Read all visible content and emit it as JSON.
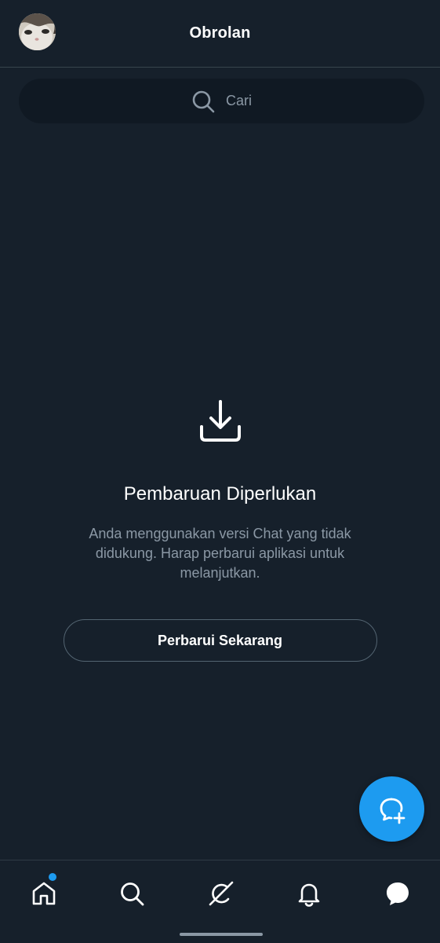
{
  "header": {
    "title": "Obrolan"
  },
  "search": {
    "placeholder": "Cari"
  },
  "empty_state": {
    "icon": "download-icon",
    "title": "Pembaruan Diperlukan",
    "description": "Anda menggunakan versi Chat yang tidak didukung. Harap perbarui aplikasi untuk melanjutkan.",
    "button_label": "Perbarui Sekarang"
  },
  "fab": {
    "icon": "new-message-icon"
  },
  "bottom_nav": {
    "items": [
      {
        "icon": "home-icon",
        "has_badge": true
      },
      {
        "icon": "search-icon"
      },
      {
        "icon": "grok-icon"
      },
      {
        "icon": "notifications-icon"
      },
      {
        "icon": "messages-icon",
        "active": true
      }
    ]
  },
  "colors": {
    "background": "#16202b",
    "accent": "#1d9bf0",
    "secondary_text": "#8b98a5",
    "border": "#38444d"
  }
}
